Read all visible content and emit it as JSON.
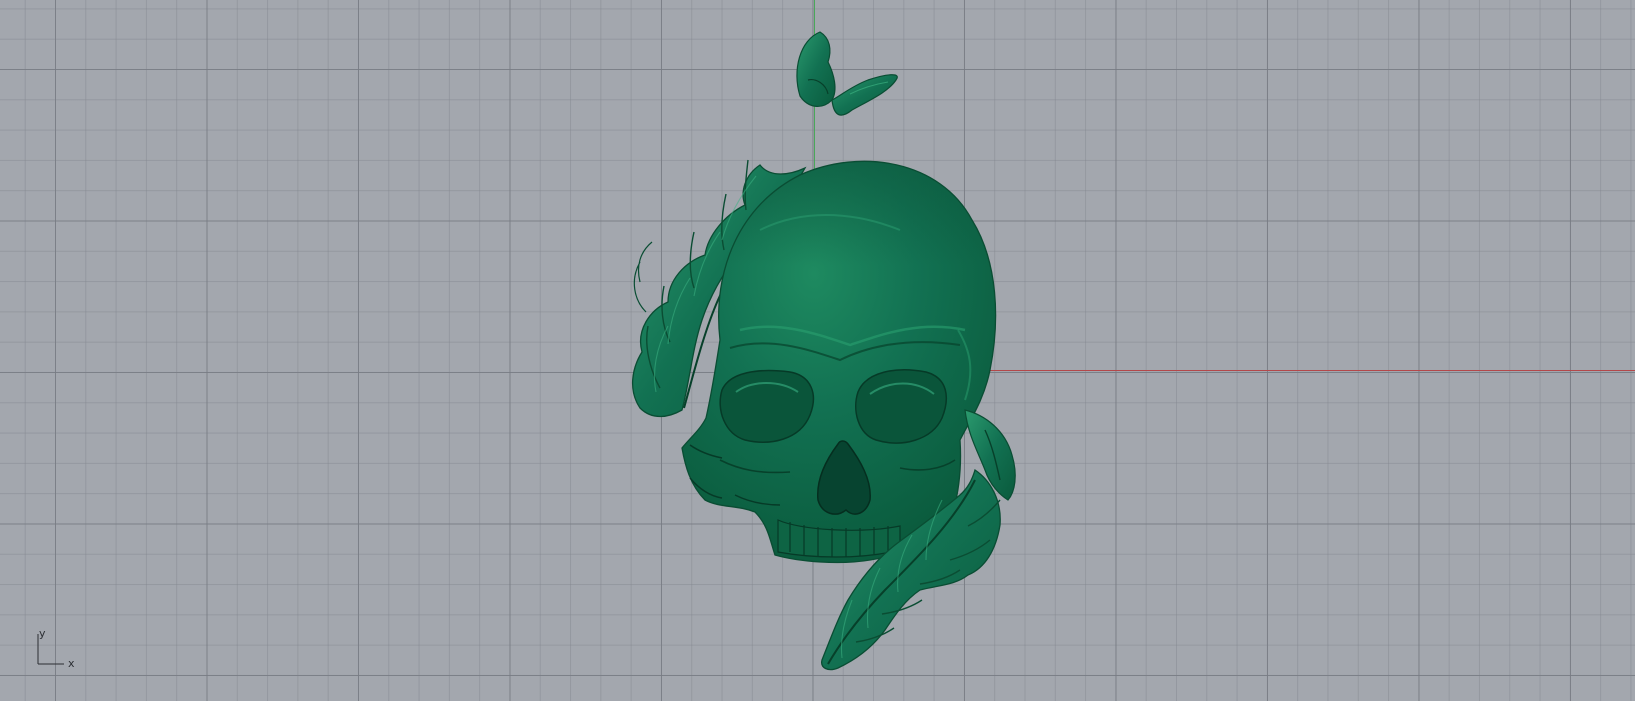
{
  "viewport": {
    "background_color": "#a3a7ae",
    "model_color": "#0f6a48",
    "axis_x_color": "#b3484a",
    "axis_y_color": "#4aa85a"
  },
  "triad": {
    "x_label": "x",
    "y_label": "y"
  },
  "model": {
    "name": "skull-with-leaves-and-butterfly"
  }
}
